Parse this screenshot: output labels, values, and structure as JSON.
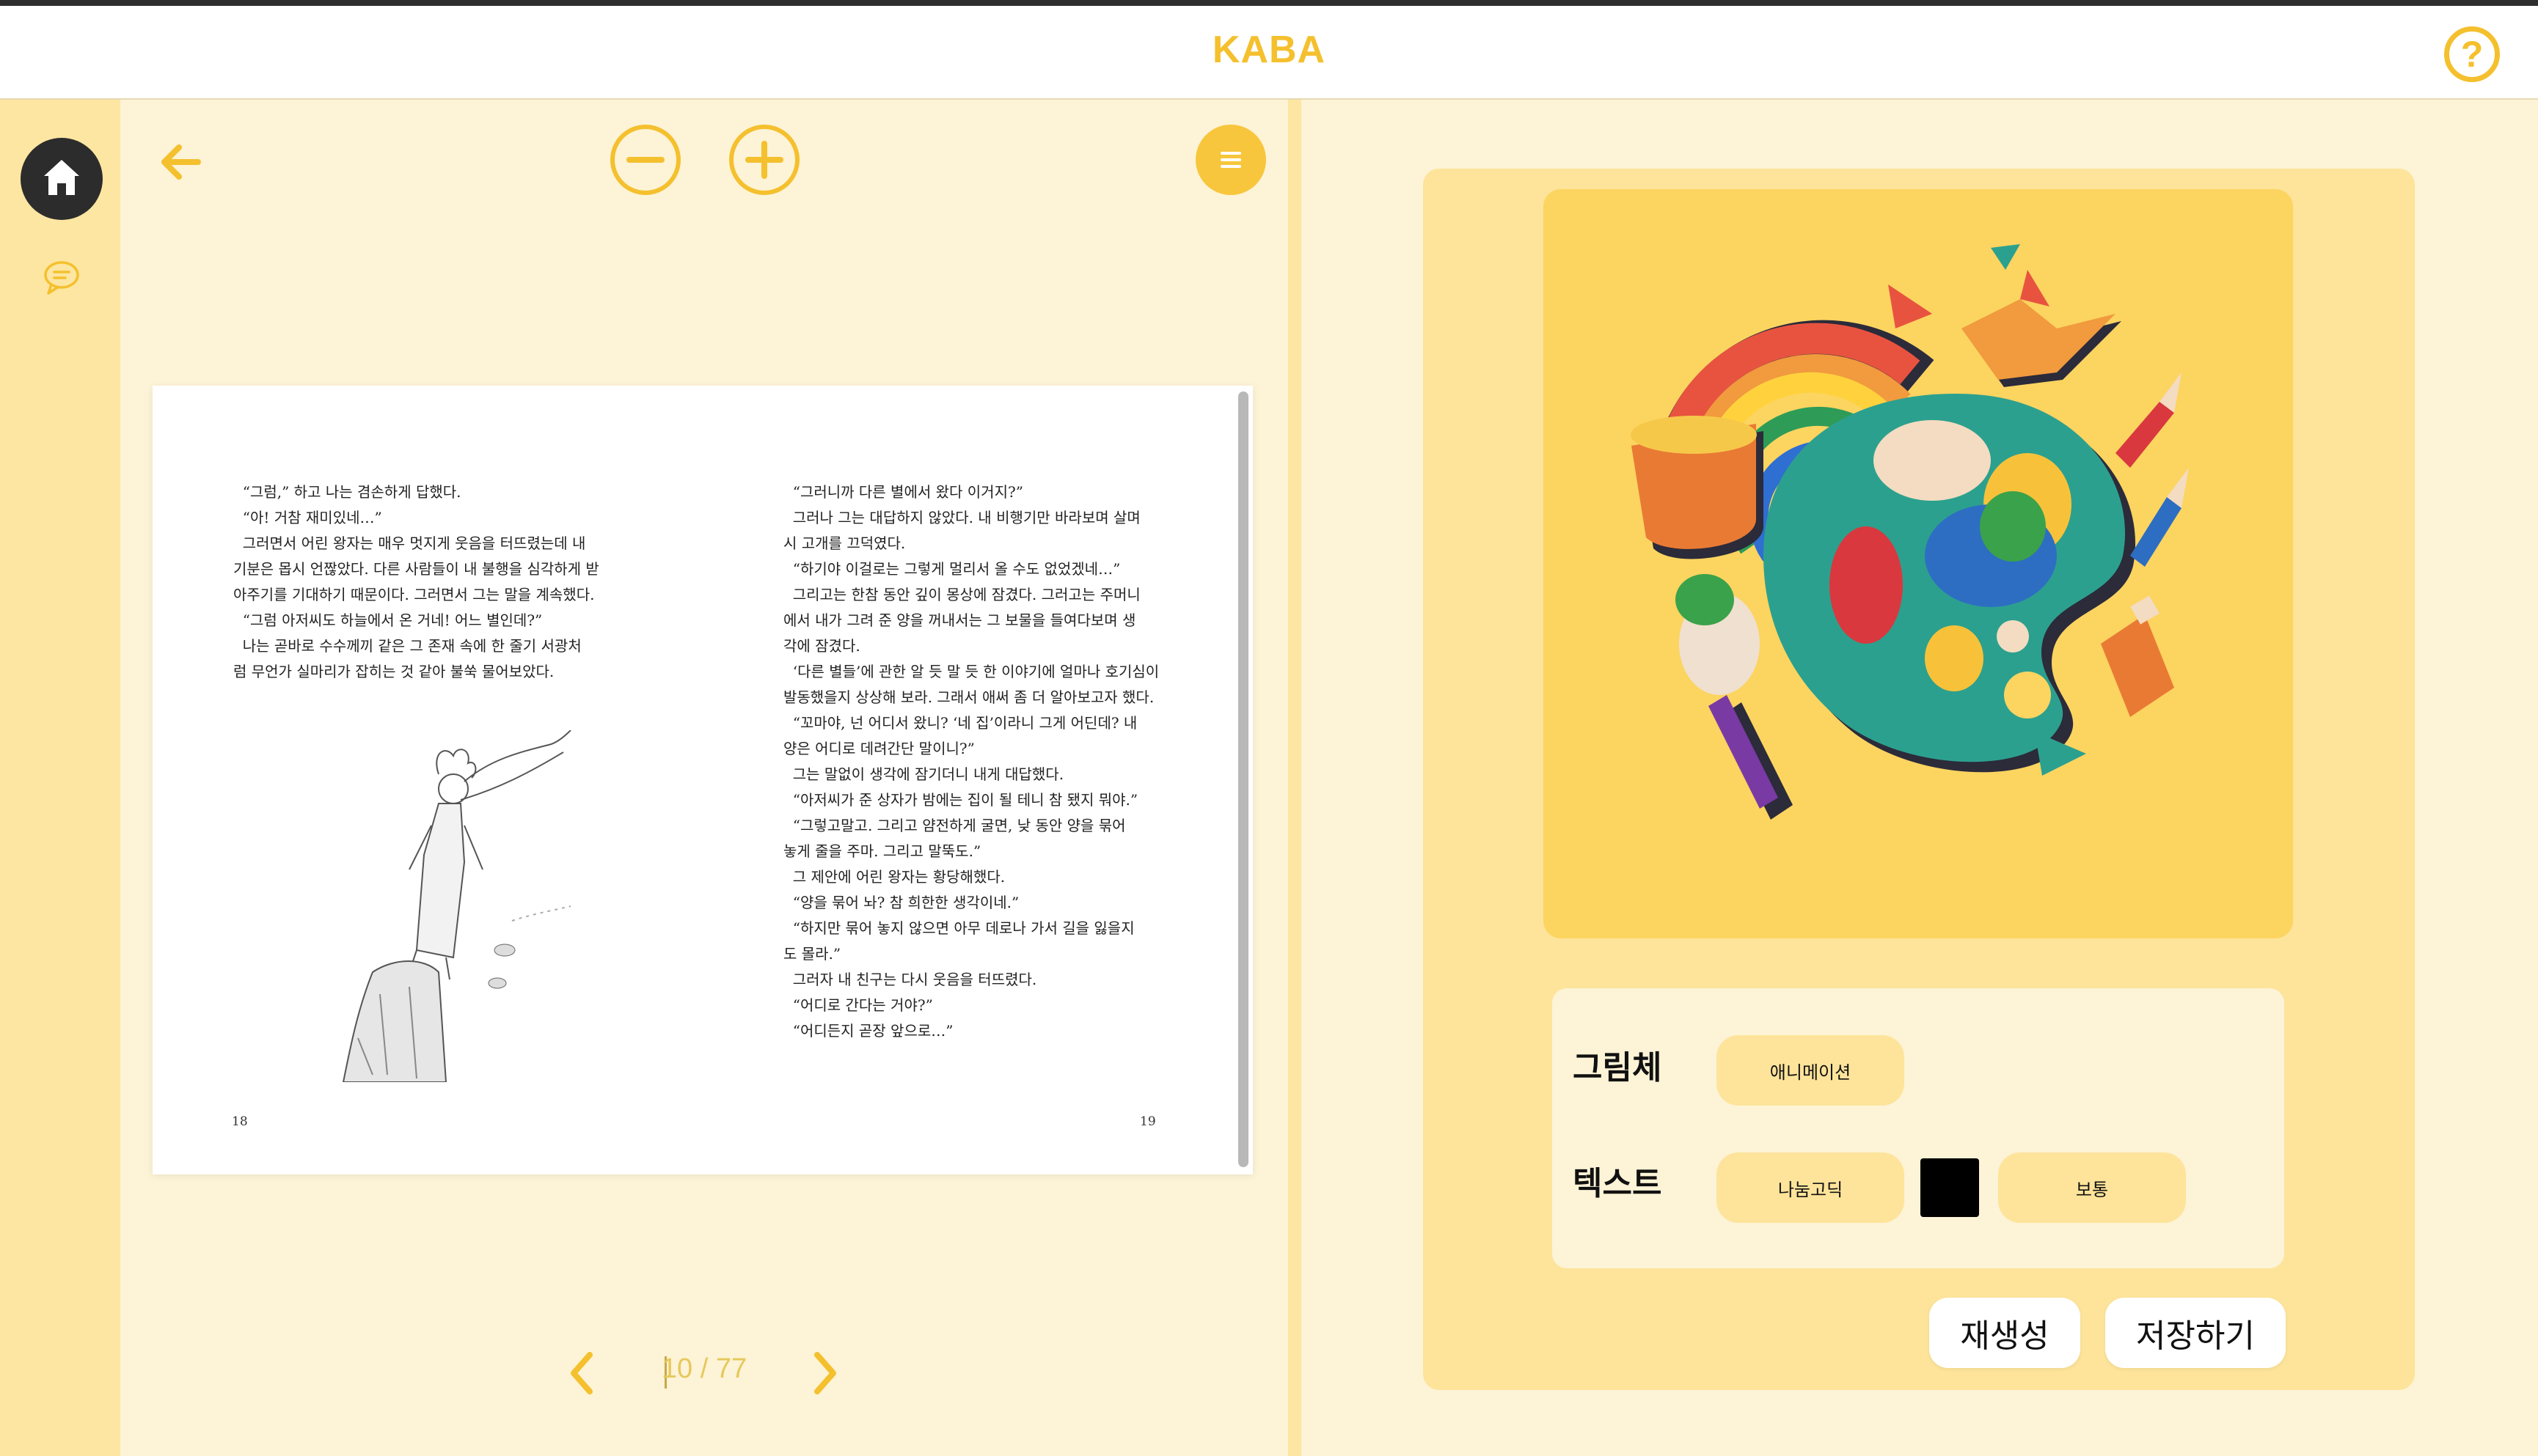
{
  "header": {
    "brand": "KABA",
    "help_icon": "help-circle-icon"
  },
  "sidebar": {
    "home_icon": "home-icon",
    "chat_icon": "chat-bubble-icon"
  },
  "toolbar": {
    "back_icon": "arrow-left-icon",
    "zoom_out_icon": "minus-circle-icon",
    "zoom_in_icon": "plus-circle-icon",
    "menu_icon": "menu-icon"
  },
  "book": {
    "left_page": {
      "paragraphs": [
        "  “그럼,” 하고 나는 겸손하게 답했다.",
        "  “아! 거참 재미있네…”",
        "  그러면서 어린 왕자는 매우 멋지게 웃음을 터뜨렸는데 내",
        "기분은 몹시 언짢았다. 다른 사람들이 내 불행을 심각하게 받",
        "아주기를 기대하기 때문이다. 그러면서 그는 말을 계속했다.",
        "  “그럼 아저씨도 하늘에서 온 거네! 어느 별인데?”",
        "  나는 곧바로 수수께끼 같은 그 존재 속에 한 줄기 서광처",
        "럼 무언가 실마리가 잡히는 것 같아 불쑥 물어보았다."
      ],
      "page_number": "18"
    },
    "right_page": {
      "paragraphs": [
        "  “그러니까 다른 별에서 왔다 이거지?”",
        "  그러나 그는 대답하지 않았다. 내 비행기만 바라보며 살며",
        "시 고개를 끄덕였다.",
        "  “하기야 이걸로는 그렇게 멀리서 올 수도 없었겠네…”",
        "  그리고는 한참 동안 깊이 몽상에 잠겼다. 그러고는 주머니",
        "에서 내가 그려 준 양을 꺼내서는 그 보물을 들여다보며 생",
        "각에 잠겼다.",
        "",
        "  ‘다른 별들’에 관한 알 듯 말 듯 한 이야기에 얼마나 호기심이",
        "발동했을지 상상해 보라. 그래서 애써 좀 더 알아보고자 했다.",
        "  “꼬마야, 넌 어디서 왔니? ‘네 집’이라니 그게 어딘데? 내",
        "양은 어디로 데려간단 말이니?”",
        "  그는 말없이 생각에 잠기더니 내게 대답했다.",
        "  “아저씨가 준 상자가 밤에는 집이 될 테니 참 됐지 뭐야.”",
        "  “그렇고말고. 그리고 얌전하게 굴면, 낮 동안 양을 묶어",
        "놓게 줄을 주마. 그리고 말뚝도.”",
        "  그 제안에 어린 왕자는 황당해했다.",
        "  “양을 묶어 놔? 참 희한한 생각이네.”",
        "  “하지만 묶어 놓지 않으면 아무 데로나 가서 길을 잃을지",
        "도 몰라.”",
        "  그러자 내 친구는 다시 웃음을 터뜨렸다.",
        "  “어디로 간다는 거야?”",
        "  “어디든지 곧장 앞으로…”"
      ],
      "page_number": "19"
    }
  },
  "pager": {
    "prev_icon": "chevron-left-icon",
    "next_icon": "chevron-right-icon",
    "text": "10 / 77"
  },
  "options": {
    "style_label": "그림체",
    "style_value": "애니메이션",
    "text_label": "텍스트",
    "font_value": "나눔고딕",
    "text_color": "#000000",
    "weight_value": "보통"
  },
  "actions": {
    "regenerate": "재생성",
    "save": "저장하기"
  },
  "colors": {
    "accent": "#f4c02e",
    "panel": "#fde49a",
    "background": "#fdf3d6"
  }
}
